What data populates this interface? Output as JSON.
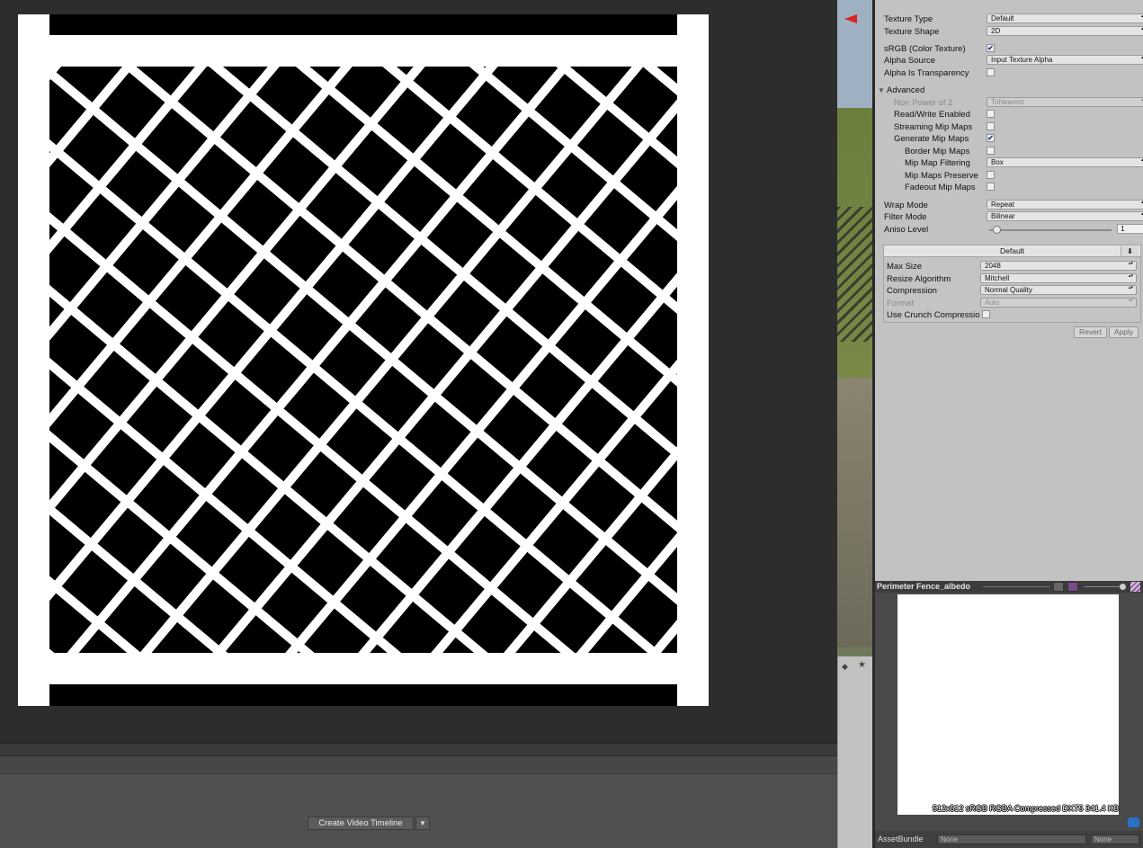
{
  "viewer": {
    "create_video_button": "Create Video Timeline"
  },
  "inspector": {
    "texture_type": {
      "label": "Texture Type",
      "value": "Default"
    },
    "texture_shape": {
      "label": "Texture Shape",
      "value": "2D"
    },
    "srgb": {
      "label": "sRGB (Color Texture)",
      "checked": true
    },
    "alpha_source": {
      "label": "Alpha Source",
      "value": "Input Texture Alpha"
    },
    "alpha_transparency": {
      "label": "Alpha Is Transparency",
      "checked": false
    },
    "advanced": {
      "label": "Advanced"
    },
    "non_power_of_2": {
      "label": "Non Power of 2",
      "value": "ToNearest"
    },
    "read_write": {
      "label": "Read/Write Enabled",
      "checked": false
    },
    "streaming_mips": {
      "label": "Streaming Mip Maps",
      "checked": false
    },
    "generate_mips": {
      "label": "Generate Mip Maps",
      "checked": true
    },
    "border_mips": {
      "label": "Border Mip Maps",
      "checked": false
    },
    "mip_filtering": {
      "label": "Mip Map Filtering",
      "value": "Box"
    },
    "mip_preserve": {
      "label": "Mip Maps Preserve",
      "checked": false
    },
    "fadeout_mips": {
      "label": "Fadeout Mip Maps",
      "checked": false
    },
    "wrap_mode": {
      "label": "Wrap Mode",
      "value": "Repeat"
    },
    "filter_mode": {
      "label": "Filter Mode",
      "value": "Bilinear"
    },
    "aniso_level": {
      "label": "Aniso Level",
      "value": "1"
    },
    "platform_tab": "Default",
    "max_size": {
      "label": "Max Size",
      "value": "2048"
    },
    "resize_algorithm": {
      "label": "Resize Algorithm",
      "value": "Mitchell"
    },
    "compression": {
      "label": "Compression",
      "value": "Normal Quality"
    },
    "format": {
      "label": "Format",
      "value": "Auto"
    },
    "crunch": {
      "label": "Use Crunch Compressio",
      "checked": false
    },
    "revert_label": "Revert",
    "apply_label": "Apply"
  },
  "preview": {
    "title": "Perimeter Fence_albedo",
    "info": "512x512  sRGB  RGBA Compressed DXT5   341.4 KB",
    "assetbundle_label": "AssetBundle",
    "assetbundle_value": "None",
    "variant_value": "None"
  },
  "colors": {
    "check": "#1a3a8a",
    "gizmo_red": "#dd2222",
    "panel_bg": "#c2c2c2"
  }
}
